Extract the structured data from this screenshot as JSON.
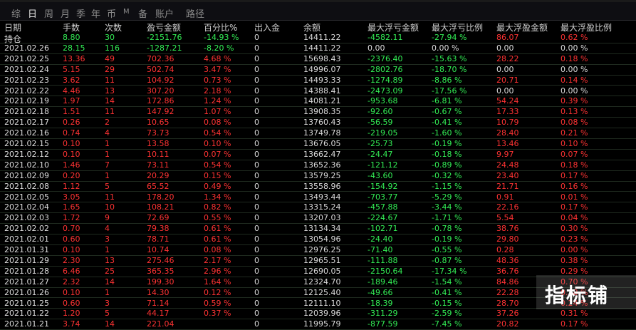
{
  "tabs": [
    {
      "label": "综",
      "active": false
    },
    {
      "label": "日",
      "active": true
    },
    {
      "label": "周",
      "active": false
    },
    {
      "label": "月",
      "active": false
    },
    {
      "label": "季",
      "active": false
    },
    {
      "label": "年",
      "active": false
    },
    {
      "label": "币",
      "active": false
    },
    {
      "label": "M",
      "active": false,
      "small": true
    },
    {
      "label": "备",
      "active": false
    },
    {
      "label": "账户",
      "active": false
    },
    {
      "label": "路径",
      "active": false
    }
  ],
  "columns": [
    "日期",
    "手数",
    "次数",
    "盈亏金额",
    "百分比%",
    "出入金",
    "余额",
    "最大浮亏金额",
    "最大浮亏比例",
    "最大浮盈金额",
    "最大浮盈比例"
  ],
  "holding": {
    "cells": [
      "持仓",
      "8.80",
      "30",
      "-2151.76",
      "-14.93 %",
      "0",
      "14411.22",
      "-4582.11",
      "-27.94 %",
      "86.07",
      "0.62 %"
    ],
    "colors": [
      "neu",
      "neg",
      "neg",
      "neg",
      "neg",
      "neu",
      "neu",
      "neg",
      "neg",
      "pos",
      "pos"
    ]
  },
  "rows": [
    {
      "cells": [
        "2021.02.26",
        "28.15",
        "116",
        "-1287.21",
        "-8.20 %",
        "0",
        "14411.22",
        "0.00",
        "0.00 %",
        "0.00",
        "0.00 %"
      ],
      "colors": [
        "neu",
        "neg",
        "neg",
        "neg",
        "neg",
        "neu",
        "neu",
        "neu",
        "neu",
        "neu",
        "neu"
      ]
    },
    {
      "cells": [
        "2021.02.25",
        "13.36",
        "49",
        "702.36",
        "4.68 %",
        "0",
        "15698.43",
        "-2376.40",
        "-15.63 %",
        "28.22",
        "0.18 %"
      ],
      "colors": [
        "neu",
        "pos",
        "pos",
        "pos",
        "pos",
        "neu",
        "neu",
        "neg",
        "neg",
        "pos",
        "pos"
      ]
    },
    {
      "cells": [
        "2021.02.24",
        "5.15",
        "29",
        "502.74",
        "3.47 %",
        "0",
        "14996.07",
        "-2802.76",
        "-18.70 %",
        "0.00",
        "0.00 %"
      ],
      "colors": [
        "neu",
        "pos",
        "pos",
        "pos",
        "pos",
        "neu",
        "neu",
        "neg",
        "neg",
        "neu",
        "neu"
      ]
    },
    {
      "cells": [
        "2021.02.23",
        "3.62",
        "11",
        "104.92",
        "0.73 %",
        "0",
        "14493.33",
        "-1274.89",
        "-8.86 %",
        "20.71",
        "0.14 %"
      ],
      "colors": [
        "neu",
        "pos",
        "pos",
        "pos",
        "pos",
        "neu",
        "neu",
        "neg",
        "neg",
        "pos",
        "pos"
      ]
    },
    {
      "cells": [
        "2021.02.22",
        "4.46",
        "13",
        "307.20",
        "2.18 %",
        "0",
        "14388.41",
        "-2473.09",
        "-17.56 %",
        "0.00",
        "0.00 %"
      ],
      "colors": [
        "neu",
        "pos",
        "pos",
        "pos",
        "pos",
        "neu",
        "neu",
        "neg",
        "neg",
        "neu",
        "neu"
      ]
    },
    {
      "cells": [
        "2021.02.19",
        "1.97",
        "14",
        "172.86",
        "1.24 %",
        "0",
        "14081.21",
        "-953.68",
        "-6.81 %",
        "54.24",
        "0.39 %"
      ],
      "colors": [
        "neu",
        "pos",
        "pos",
        "pos",
        "pos",
        "neu",
        "neu",
        "neg",
        "neg",
        "pos",
        "pos"
      ]
    },
    {
      "cells": [
        "2021.02.18",
        "1.51",
        "11",
        "147.92",
        "1.07 %",
        "0",
        "13908.35",
        "-92.60",
        "-0.67 %",
        "17.33",
        "0.13 %"
      ],
      "colors": [
        "neu",
        "pos",
        "pos",
        "pos",
        "pos",
        "neu",
        "neu",
        "neg",
        "neg",
        "pos",
        "pos"
      ]
    },
    {
      "cells": [
        "2021.02.17",
        "0.26",
        "2",
        "10.65",
        "0.08 %",
        "0",
        "13760.43",
        "-56.59",
        "-0.41 %",
        "10.79",
        "0.08 %"
      ],
      "colors": [
        "neu",
        "pos",
        "pos",
        "pos",
        "pos",
        "neu",
        "neu",
        "neg",
        "neg",
        "pos",
        "pos"
      ]
    },
    {
      "cells": [
        "2021.02.16",
        "0.74",
        "4",
        "73.73",
        "0.54 %",
        "0",
        "13749.78",
        "-219.05",
        "-1.60 %",
        "28.40",
        "0.21 %"
      ],
      "colors": [
        "neu",
        "pos",
        "pos",
        "pos",
        "pos",
        "neu",
        "neu",
        "neg",
        "neg",
        "pos",
        "pos"
      ]
    },
    {
      "cells": [
        "2021.02.15",
        "0.10",
        "1",
        "13.58",
        "0.10 %",
        "0",
        "13676.05",
        "-25.73",
        "-0.19 %",
        "13.46",
        "0.10 %"
      ],
      "colors": [
        "neu",
        "pos",
        "pos",
        "pos",
        "pos",
        "neu",
        "neu",
        "neg",
        "neg",
        "pos",
        "pos"
      ]
    },
    {
      "cells": [
        "2021.02.12",
        "0.10",
        "1",
        "10.11",
        "0.07 %",
        "0",
        "13662.47",
        "-24.47",
        "-0.18 %",
        "9.97",
        "0.07 %"
      ],
      "colors": [
        "neu",
        "pos",
        "pos",
        "pos",
        "pos",
        "neu",
        "neu",
        "neg",
        "neg",
        "pos",
        "pos"
      ]
    },
    {
      "cells": [
        "2021.02.10",
        "1.46",
        "7",
        "73.11",
        "0.54 %",
        "0",
        "13652.36",
        "-121.12",
        "-0.89 %",
        "24.48",
        "0.18 %"
      ],
      "colors": [
        "neu",
        "pos",
        "pos",
        "pos",
        "pos",
        "neu",
        "neu",
        "neg",
        "neg",
        "pos",
        "pos"
      ]
    },
    {
      "cells": [
        "2021.02.09",
        "0.20",
        "1",
        "20.29",
        "0.15 %",
        "0",
        "13579.25",
        "-43.60",
        "-0.32 %",
        "23.40",
        "0.17 %"
      ],
      "colors": [
        "neu",
        "pos",
        "pos",
        "pos",
        "pos",
        "neu",
        "neu",
        "neg",
        "neg",
        "pos",
        "pos"
      ]
    },
    {
      "cells": [
        "2021.02.08",
        "1.12",
        "5",
        "65.52",
        "0.49 %",
        "0",
        "13558.96",
        "-154.92",
        "-1.15 %",
        "21.71",
        "0.16 %"
      ],
      "colors": [
        "neu",
        "pos",
        "pos",
        "pos",
        "pos",
        "neu",
        "neu",
        "neg",
        "neg",
        "pos",
        "pos"
      ]
    },
    {
      "cells": [
        "2021.02.05",
        "3.05",
        "11",
        "178.20",
        "1.34 %",
        "0",
        "13493.44",
        "-703.77",
        "-5.29 %",
        "0.91",
        "0.01 %"
      ],
      "colors": [
        "neu",
        "pos",
        "pos",
        "pos",
        "pos",
        "neu",
        "neu",
        "neg",
        "neg",
        "pos",
        "pos"
      ]
    },
    {
      "cells": [
        "2021.02.04",
        "1.65",
        "10",
        "108.21",
        "0.82 %",
        "0",
        "13315.24",
        "-457.88",
        "-3.44 %",
        "22.16",
        "0.17 %"
      ],
      "colors": [
        "neu",
        "pos",
        "pos",
        "pos",
        "pos",
        "neu",
        "neu",
        "neg",
        "neg",
        "pos",
        "pos"
      ]
    },
    {
      "cells": [
        "2021.02.03",
        "1.72",
        "9",
        "72.69",
        "0.55 %",
        "0",
        "13207.03",
        "-224.67",
        "-1.71 %",
        "5.54",
        "0.04 %"
      ],
      "colors": [
        "neu",
        "pos",
        "pos",
        "pos",
        "pos",
        "neu",
        "neu",
        "neg",
        "neg",
        "pos",
        "pos"
      ]
    },
    {
      "cells": [
        "2021.02.02",
        "0.70",
        "4",
        "79.38",
        "0.61 %",
        "0",
        "13134.34",
        "-102.71",
        "-0.78 %",
        "38.76",
        "0.30 %"
      ],
      "colors": [
        "neu",
        "pos",
        "pos",
        "pos",
        "pos",
        "neu",
        "neu",
        "neg",
        "neg",
        "pos",
        "pos"
      ]
    },
    {
      "cells": [
        "2021.02.01",
        "0.60",
        "3",
        "78.71",
        "0.61 %",
        "0",
        "13054.96",
        "-24.40",
        "-0.19 %",
        "29.80",
        "0.23 %"
      ],
      "colors": [
        "neu",
        "pos",
        "pos",
        "pos",
        "pos",
        "neu",
        "neu",
        "neg",
        "neg",
        "pos",
        "pos"
      ]
    },
    {
      "cells": [
        "2021.01.31",
        "0.10",
        "1",
        "10.74",
        "0.08 %",
        "0",
        "12976.25",
        "-71.40",
        "-0.55 %",
        "0.28",
        "0.00 %"
      ],
      "colors": [
        "neu",
        "pos",
        "pos",
        "pos",
        "pos",
        "neu",
        "neu",
        "neg",
        "neg",
        "pos",
        "pos"
      ]
    },
    {
      "cells": [
        "2021.01.29",
        "2.30",
        "13",
        "275.46",
        "2.17 %",
        "0",
        "12965.51",
        "-111.88",
        "-0.87 %",
        "48.36",
        "0.38 %"
      ],
      "colors": [
        "neu",
        "pos",
        "pos",
        "pos",
        "pos",
        "neu",
        "neu",
        "neg",
        "neg",
        "pos",
        "pos"
      ]
    },
    {
      "cells": [
        "2021.01.28",
        "6.46",
        "25",
        "365.35",
        "2.96 %",
        "0",
        "12690.05",
        "-2150.64",
        "-17.34 %",
        "36.76",
        "0.29 %"
      ],
      "colors": [
        "neu",
        "pos",
        "pos",
        "pos",
        "pos",
        "neu",
        "neu",
        "neg",
        "neg",
        "pos",
        "pos"
      ]
    },
    {
      "cells": [
        "2021.01.27",
        "2.32",
        "14",
        "199.30",
        "1.64 %",
        "0",
        "12324.70",
        "-189.46",
        "-1.54 %",
        "84.86",
        "0.70 %"
      ],
      "colors": [
        "neu",
        "pos",
        "pos",
        "pos",
        "pos",
        "neu",
        "neu",
        "neg",
        "neg",
        "pos",
        "pos"
      ]
    },
    {
      "cells": [
        "2021.01.26",
        "0.10",
        "1",
        "14.30",
        "0.12 %",
        "0",
        "12125.40",
        "-49.66",
        "-0.41 %",
        "22.28",
        "0.18 %"
      ],
      "colors": [
        "neu",
        "pos",
        "pos",
        "pos",
        "pos",
        "neu",
        "neu",
        "neg",
        "neg",
        "pos",
        "pos"
      ]
    },
    {
      "cells": [
        "2021.01.25",
        "0.60",
        "3",
        "71.14",
        "0.59 %",
        "0",
        "12111.10",
        "-18.39",
        "-0.15 %",
        "28.70",
        "0.24 %"
      ],
      "colors": [
        "neu",
        "pos",
        "pos",
        "pos",
        "pos",
        "neu",
        "neu",
        "neg",
        "neg",
        "pos",
        "pos"
      ]
    },
    {
      "cells": [
        "2021.01.22",
        "1.20",
        "5",
        "44.17",
        "0.37 %",
        "0",
        "12039.96",
        "-311.29",
        "-2.59 %",
        "37.26",
        "0.31 %"
      ],
      "colors": [
        "neu",
        "pos",
        "pos",
        "pos",
        "pos",
        "neu",
        "neu",
        "neg",
        "neg",
        "pos",
        "pos"
      ]
    },
    {
      "cells": [
        "2021.01.21",
        "3.74",
        "14",
        "221.04",
        "",
        "0",
        "11995.79",
        "-877.59",
        "-7.45 %",
        "20.82",
        "0.17 %"
      ],
      "colors": [
        "neu",
        "pos",
        "pos",
        "pos",
        "pos",
        "neu",
        "neu",
        "neg",
        "neg",
        "pos",
        "pos"
      ]
    }
  ],
  "watermark": "指标铺"
}
